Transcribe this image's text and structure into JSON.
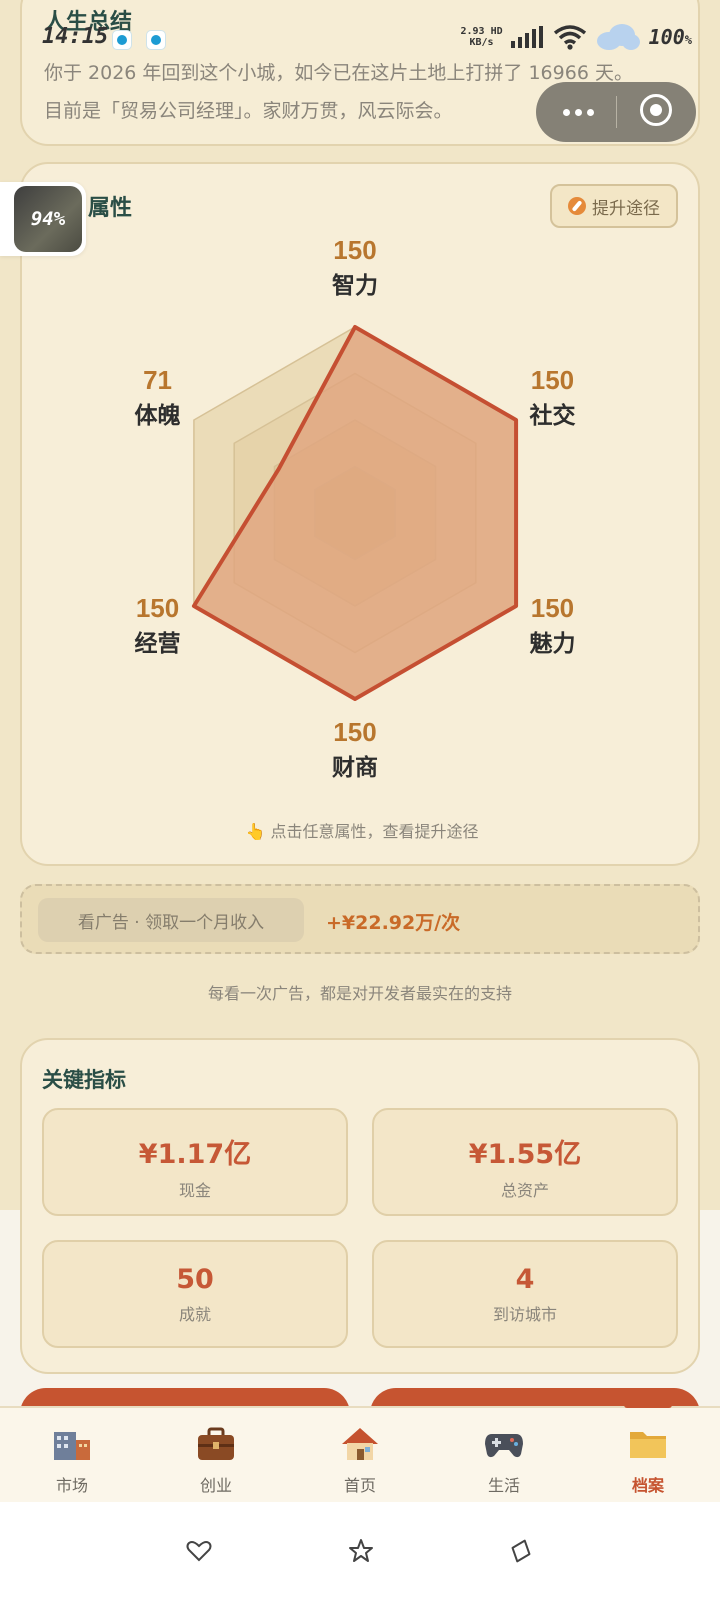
{
  "status_bar": {
    "time": "14:15",
    "net_speed_value": "2.93",
    "net_speed_unit": "KB/s",
    "network_label": "HD",
    "battery": "100",
    "battery_unit": "%"
  },
  "summary": {
    "title": "人生总结",
    "line1": "你于 2026 年回到这个小城，如今已在这片土地上打拼了 16966 天。",
    "line2": "目前是「贸易公司经理」。家财万贯，风云际会。"
  },
  "floating_badge": {
    "percent": "94%"
  },
  "attributes": {
    "title": "属性",
    "improve_button": "提升途径",
    "tip": "👆 点击任意属性，查看提升途径",
    "max": 150,
    "items": [
      {
        "name": "智力",
        "value": 150
      },
      {
        "name": "社交",
        "value": 150
      },
      {
        "name": "魅力",
        "value": 150
      },
      {
        "name": "财商",
        "value": 150
      },
      {
        "name": "经营",
        "value": 150
      },
      {
        "name": "体魄",
        "value": 71
      }
    ],
    "colors": {
      "fill": "#e0a27c",
      "stroke": "#c54f32",
      "grid": "#e7d6b0",
      "value": "#b8762e"
    }
  },
  "ad": {
    "button": "看广告 · 领取一个月收入",
    "reward": "+¥22.92万/次",
    "support": "每看一次广告，都是对开发者最实在的支持"
  },
  "kpis": {
    "title": "关键指标",
    "items": [
      {
        "value": "¥1.17亿",
        "label": "现金"
      },
      {
        "value": "¥1.55亿",
        "label": "总资产"
      },
      {
        "value": "50",
        "label": "成就"
      },
      {
        "value": "4",
        "label": "到访城市"
      }
    ]
  },
  "nav": {
    "items": [
      {
        "label": "市场",
        "icon": "market-building-icon"
      },
      {
        "label": "创业",
        "icon": "briefcase-icon"
      },
      {
        "label": "首页",
        "icon": "house-icon"
      },
      {
        "label": "生活",
        "icon": "gamepad-icon"
      },
      {
        "label": "档案",
        "icon": "folder-icon"
      }
    ],
    "active": "档案"
  }
}
